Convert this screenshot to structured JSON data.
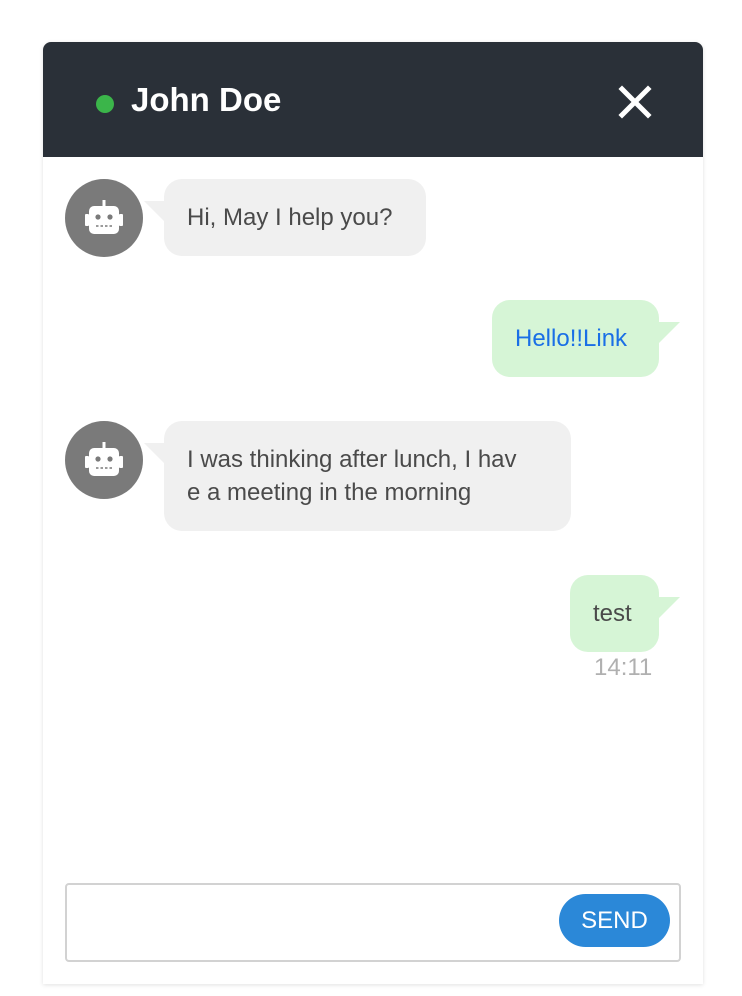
{
  "header": {
    "contact_name": "John Doe",
    "status": "online",
    "status_color": "#3bb54a",
    "close_icon": "close-icon"
  },
  "messages": [
    {
      "direction": "incoming",
      "avatar_icon": "robot-icon",
      "text": "Hi, May I help you?"
    },
    {
      "direction": "outgoing",
      "text": "Hello!!Link",
      "is_link": true
    },
    {
      "direction": "incoming",
      "avatar_icon": "robot-icon",
      "lines": [
        "I was thinking after lunch, I hav",
        "e a meeting in the morning"
      ]
    },
    {
      "direction": "outgoing",
      "text": "test",
      "time": "14:11"
    }
  ],
  "composer": {
    "input_value": "",
    "input_placeholder": "",
    "send_label": "SEND",
    "send_color": "#2b88d8"
  },
  "colors": {
    "header_bg": "#2a3038",
    "incoming_bubble": "#f0f0f0",
    "outgoing_bubble": "#d6f5d6",
    "link": "#1a6fe6"
  }
}
